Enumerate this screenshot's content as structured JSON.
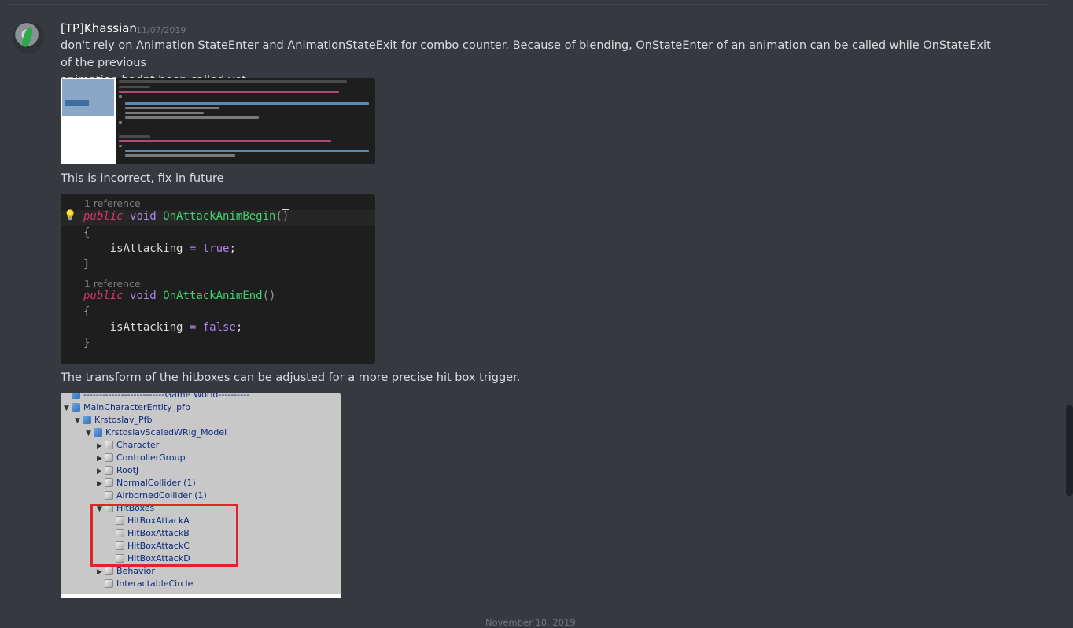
{
  "message": {
    "author": "[TP]Khassian",
    "timestamp": "11/07/2019",
    "text1": "don't rely on Animation StateEnter and AnimationStateExit for combo counter. Because of blending, OnStateEnter of an animation can be called while OnStateExit of the previous",
    "text1b": "animation hadnt been called yet.",
    "text2": "This is incorrect, fix in future",
    "text3": "The transform of the hitboxes can be adjusted for a more precise hit box trigger."
  },
  "code": {
    "ref1": "1 reference",
    "ref2": "1 reference",
    "kw_public": "public",
    "kw_void": "void",
    "fn_begin": "OnAttackAnimBegin",
    "fn_end": "OnAttackAnimEnd",
    "var": "isAttacking",
    "val_true": "true",
    "val_false": "false"
  },
  "hierarchy": {
    "items": [
      {
        "label": "--------------------------Game World----------",
        "cube": "blue"
      },
      {
        "label": "MainCharacterEntity_pfb",
        "cube": "blue",
        "arrow": "▼"
      },
      {
        "label": "Krstoslav_Pfb",
        "cube": "blue",
        "arrow": "▼"
      },
      {
        "label": "KrstoslavScaledWRig_Model",
        "cube": "blue",
        "arrow": "▼"
      },
      {
        "label": "Character",
        "cube": "grey",
        "arrow": "▶"
      },
      {
        "label": "ControllerGroup",
        "cube": "grey",
        "arrow": "▶"
      },
      {
        "label": "RootJ",
        "cube": "grey",
        "arrow": "▶"
      },
      {
        "label": "NormalCollider (1)",
        "cube": "grey",
        "arrow": "▶"
      },
      {
        "label": "AirbornedCollider (1)",
        "cube": "grey",
        "arrow": ""
      },
      {
        "label": "HitBoxes",
        "cube": "grey",
        "arrow": "▼"
      },
      {
        "label": "HitBoxAttackA",
        "cube": "grey",
        "arrow": ""
      },
      {
        "label": "HitBoxAttackB",
        "cube": "grey",
        "arrow": ""
      },
      {
        "label": "HitBoxAttackC",
        "cube": "grey",
        "arrow": ""
      },
      {
        "label": "HitBoxAttackD",
        "cube": "grey",
        "arrow": ""
      },
      {
        "label": "Behavior",
        "cube": "grey",
        "arrow": "▶"
      },
      {
        "label": "InteractableCircle",
        "cube": "grey",
        "arrow": ""
      }
    ]
  },
  "date_divider": "November 10, 2019"
}
